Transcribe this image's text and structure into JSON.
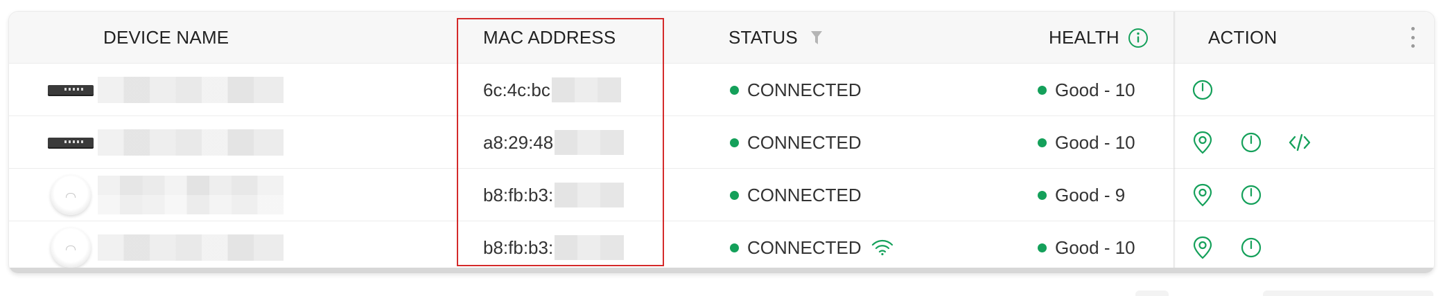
{
  "table": {
    "columns": {
      "device_name": "DEVICE NAME",
      "mac_address": "MAC ADDRESS",
      "status": "STATUS",
      "health": "HEALTH",
      "action": "ACTION"
    },
    "rows": [
      {
        "device_type": "switch",
        "mac_prefix": "6c:4c:bc",
        "status": "CONNECTED",
        "wireless": false,
        "health": "Good - 10",
        "actions": [
          "power-icon"
        ]
      },
      {
        "device_type": "switch",
        "mac_prefix": "a8:29:48",
        "status": "CONNECTED",
        "wireless": false,
        "health": "Good - 10",
        "actions": [
          "locate-icon",
          "power-icon",
          "code-icon"
        ]
      },
      {
        "device_type": "access-point",
        "mac_prefix": "b8:fb:b3:",
        "status": "CONNECTED",
        "wireless": false,
        "health": "Good - 9",
        "actions": [
          "locate-icon",
          "power-icon"
        ]
      },
      {
        "device_type": "access-point",
        "mac_prefix": "b8:fb:b3:",
        "status": "CONNECTED",
        "wireless": true,
        "health": "Good - 10",
        "actions": [
          "locate-icon",
          "power-icon"
        ]
      }
    ]
  },
  "colors": {
    "accent": "#14a05a",
    "highlight": "#d42a2a",
    "header_bg": "#f7f7f7"
  },
  "icons": [
    "filter-icon",
    "info-icon",
    "more-vertical-icon",
    "power-icon",
    "locate-icon",
    "code-icon",
    "wifi-icon"
  ]
}
